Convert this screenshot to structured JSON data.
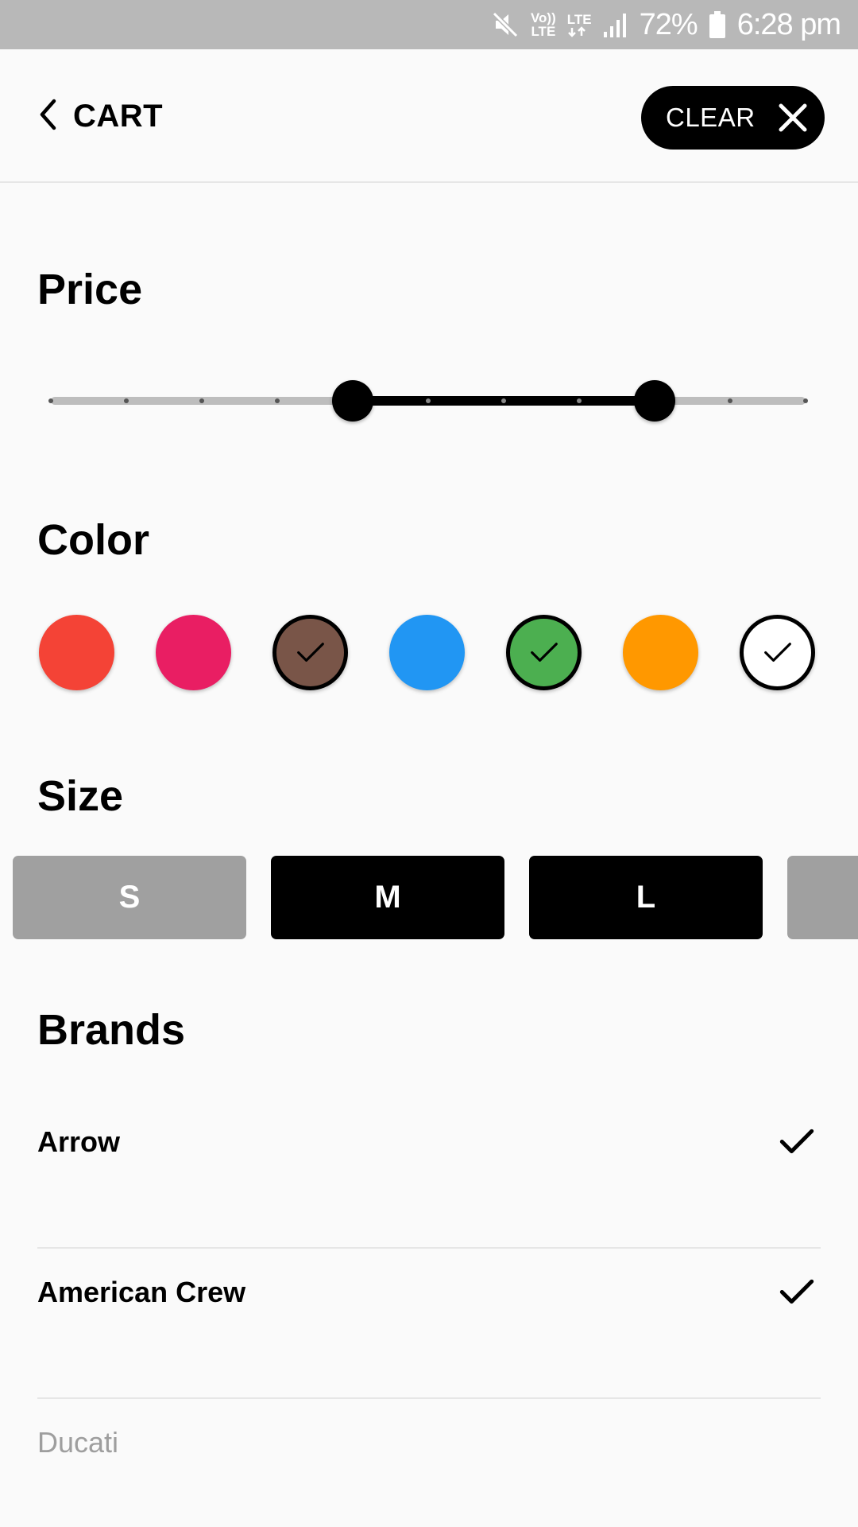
{
  "status_bar": {
    "battery": "72%",
    "time": "6:28 pm",
    "volte_top": "Vo))",
    "volte_bottom": "LTE",
    "lte": "LTE",
    "icons": [
      "mute-icon",
      "volte-icon",
      "lte-icon",
      "signal-icon",
      "battery-icon"
    ]
  },
  "header": {
    "back_icon": "chevron-left-icon",
    "title": "CART",
    "clear_label": "CLEAR",
    "clear_icon": "close-icon"
  },
  "price": {
    "title": "Price",
    "slider": {
      "steps": 11,
      "range_start_step": 4,
      "range_end_step": 8
    }
  },
  "color": {
    "title": "Color",
    "swatches": [
      {
        "hex": "#f44336",
        "selected": false
      },
      {
        "hex": "#e91e63",
        "selected": false
      },
      {
        "hex": "#795548",
        "selected": true
      },
      {
        "hex": "#2196f3",
        "selected": false
      },
      {
        "hex": "#4caf50",
        "selected": true
      },
      {
        "hex": "#ff9800",
        "selected": false
      },
      {
        "hex": "#ffffff",
        "selected": true
      }
    ]
  },
  "size": {
    "title": "Size",
    "options": [
      {
        "label": "S",
        "selected": false
      },
      {
        "label": "M",
        "selected": true
      },
      {
        "label": "L",
        "selected": true
      },
      {
        "label": "",
        "selected": false
      }
    ]
  },
  "brands": {
    "title": "Brands",
    "items": [
      {
        "label": "Arrow",
        "selected": true
      },
      {
        "label": "American Crew",
        "selected": true
      },
      {
        "label": "Ducati",
        "selected": false
      }
    ]
  }
}
